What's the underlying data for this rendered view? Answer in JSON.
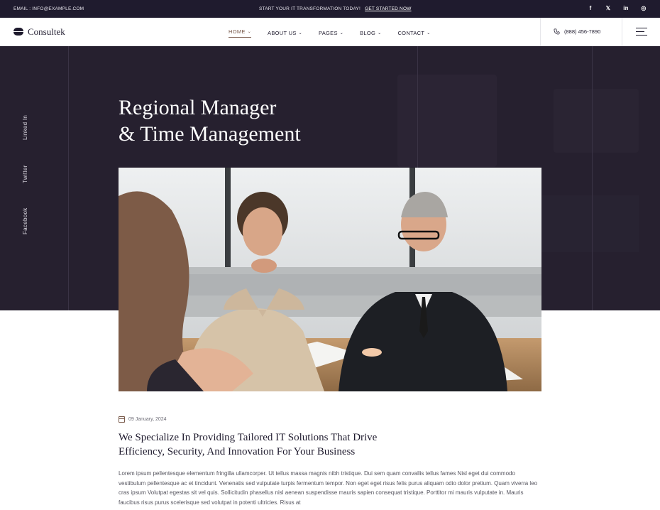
{
  "topbar": {
    "email": "EMAIL : INFO@EXAMPLE.COM",
    "promo_text": "START YOUR IT TRANSFORMATION TODAY!",
    "promo_link": "GET STARTED NOW",
    "social": [
      "f",
      "𝕏",
      "in",
      "◎"
    ]
  },
  "nav": {
    "logo_text": "Consultek",
    "menu": [
      {
        "label": "HOME",
        "caret": "⌄"
      },
      {
        "label": "ABOUT US",
        "caret": "⌄"
      },
      {
        "label": "PAGES",
        "caret": "⌄"
      },
      {
        "label": "BLOG",
        "caret": "⌄"
      },
      {
        "label": "CONTACT",
        "caret": "⌄"
      }
    ],
    "phone": "(888) 456-7890"
  },
  "hero": {
    "title_line1": "Regional Manager",
    "title_line2": "& Time Management",
    "social_vertical": [
      "Linked In",
      "Twitter",
      "Facebook"
    ]
  },
  "post": {
    "date": "09 January, 2024",
    "headline": "We Specialize In Providing Tailored IT Solutions That Drive Efficiency, Security, And Innovation For Your Business",
    "body": "Lorem ipsum pellentesque elementum fringilla ullamcorper. Ut tellus massa magnis nibh tristique. Dui sem quam convallis tellus fames Nisl eget dui commodo vestibulum pellentesque ac et tincidunt. Venenatis sed vulputate turpis fermentum tempor. Non eget eget risus felis purus aliquam odio dolor pretium. Quam viverra leo cras ipsum Volutpat egestas sit vel quis. Sollicitudin phasellus nisl aenean suspendisse mauris sapien consequat tristique. Porttitor mi mauris vulputate in. Mauris faucibus risus purus scelerisque sed volutpat in potenti ultricies. Risus at"
  }
}
